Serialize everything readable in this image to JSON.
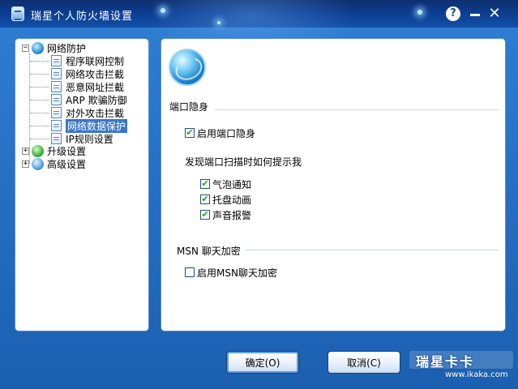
{
  "window": {
    "title": "瑞星个人防火墙设置",
    "accent_color": "#1b5fb0",
    "controls": {
      "help": "?",
      "minimize": "",
      "close": "✕"
    }
  },
  "tree": {
    "root": {
      "label": "网络防护",
      "expander": "−",
      "icon": "globe-icon",
      "children": [
        {
          "label": "程序联网控制",
          "icon": "page-icon"
        },
        {
          "label": "网络攻击拦截",
          "icon": "page-icon"
        },
        {
          "label": "恶意网址拦截",
          "icon": "page-icon"
        },
        {
          "label": "ARP 欺骗防御",
          "icon": "page-icon"
        },
        {
          "label": "对外攻击拦截",
          "icon": "page-icon"
        },
        {
          "label": "网络数据保护",
          "icon": "page-icon",
          "selected": true
        },
        {
          "label": "IP规则设置",
          "icon": "page-icon"
        }
      ]
    },
    "others": [
      {
        "label": "升级设置",
        "expander": "+",
        "icon": "upgrade-icon"
      },
      {
        "label": "高级设置",
        "expander": "+",
        "icon": "settings-icon"
      }
    ]
  },
  "content": {
    "port_stealth": {
      "section_title": "端口隐身",
      "enable": {
        "label": "启用端口隐身",
        "checked": true
      },
      "prompt_title": "发现端口扫描时如何提示我",
      "options": [
        {
          "label": "气泡通知",
          "checked": true
        },
        {
          "label": "托盘动画",
          "checked": true
        },
        {
          "label": "声音报警",
          "checked": true
        }
      ]
    },
    "msn": {
      "section_title": "MSN 聊天加密",
      "enable": {
        "label": "启用MSN聊天加密",
        "checked": false
      }
    }
  },
  "buttons": {
    "ok": "确定(O)",
    "cancel": "取消(C)"
  },
  "watermark": {
    "title": "瑞星卡卡",
    "url": "www.ikaka.com"
  }
}
